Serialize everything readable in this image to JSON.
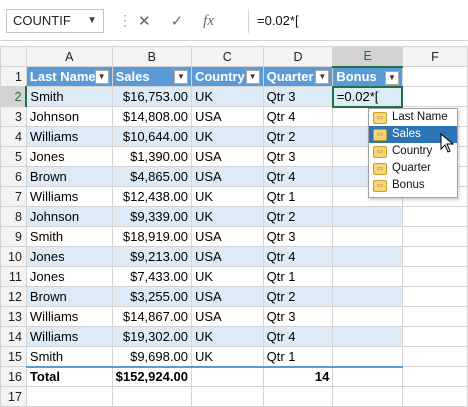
{
  "formula_bar": {
    "name_box": "COUNTIF",
    "cancel_icon": "✕",
    "enter_icon": "✓",
    "fx_icon": "fx",
    "formula": "=0.02*["
  },
  "columns": [
    "A",
    "B",
    "C",
    "D",
    "E",
    "F"
  ],
  "table_headers": [
    "Last Name",
    "Sales",
    "Country",
    "Quarter",
    "Bonus"
  ],
  "rows": [
    {
      "num": "1"
    },
    {
      "num": "2",
      "name": "Smith",
      "sales": "$16,753.00",
      "country": "UK",
      "quarter": "Qtr 3",
      "bonus": "=0.02*["
    },
    {
      "num": "3",
      "name": "Johnson",
      "sales": "$14,808.00",
      "country": "USA",
      "quarter": "Qtr 4",
      "bonus": ""
    },
    {
      "num": "4",
      "name": "Williams",
      "sales": "$10,644.00",
      "country": "UK",
      "quarter": "Qtr 2",
      "bonus": ""
    },
    {
      "num": "5",
      "name": "Jones",
      "sales": "$1,390.00",
      "country": "USA",
      "quarter": "Qtr 3",
      "bonus": ""
    },
    {
      "num": "6",
      "name": "Brown",
      "sales": "$4,865.00",
      "country": "USA",
      "quarter": "Qtr 4",
      "bonus": ""
    },
    {
      "num": "7",
      "name": "Williams",
      "sales": "$12,438.00",
      "country": "UK",
      "quarter": "Qtr 1",
      "bonus": ""
    },
    {
      "num": "8",
      "name": "Johnson",
      "sales": "$9,339.00",
      "country": "UK",
      "quarter": "Qtr 2",
      "bonus": ""
    },
    {
      "num": "9",
      "name": "Smith",
      "sales": "$18,919.00",
      "country": "USA",
      "quarter": "Qtr 3",
      "bonus": ""
    },
    {
      "num": "10",
      "name": "Jones",
      "sales": "$9,213.00",
      "country": "USA",
      "quarter": "Qtr 4",
      "bonus": ""
    },
    {
      "num": "11",
      "name": "Jones",
      "sales": "$7,433.00",
      "country": "UK",
      "quarter": "Qtr 1",
      "bonus": ""
    },
    {
      "num": "12",
      "name": "Brown",
      "sales": "$3,255.00",
      "country": "USA",
      "quarter": "Qtr 2",
      "bonus": ""
    },
    {
      "num": "13",
      "name": "Williams",
      "sales": "$14,867.00",
      "country": "USA",
      "quarter": "Qtr 3",
      "bonus": ""
    },
    {
      "num": "14",
      "name": "Williams",
      "sales": "$19,302.00",
      "country": "UK",
      "quarter": "Qtr 4",
      "bonus": ""
    },
    {
      "num": "15",
      "name": "Smith",
      "sales": "$9,698.00",
      "country": "UK",
      "quarter": "Qtr 1",
      "bonus": ""
    },
    {
      "num": "16",
      "name": "Total",
      "sales": "$152,924.00",
      "country": "",
      "quarter": "14",
      "bonus": ""
    },
    {
      "num": "17"
    }
  ],
  "autocomplete": [
    "Last Name",
    "Sales",
    "Country",
    "Quarter",
    "Bonus"
  ],
  "autocomplete_selected": "Sales",
  "autocomplete_icon": "field-icon",
  "colors": {
    "table_header": "#5b9bd5",
    "band": "#ddebf7",
    "selection": "#217346",
    "list_highlight": "#2e75b6"
  }
}
